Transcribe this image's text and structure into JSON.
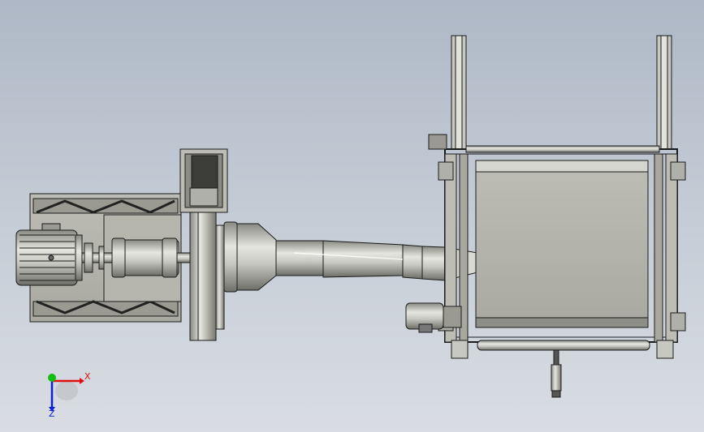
{
  "viewport": {
    "background_top": "#aeb8c6",
    "background_bottom": "#d9dde3",
    "model_fill": "#c2c2bc",
    "model_stroke": "#1a1a1a"
  },
  "triad": {
    "x_label": "X",
    "z_label": "Z",
    "x_color": "#e01010",
    "y_color": "#10c010",
    "z_color": "#1020d0"
  }
}
